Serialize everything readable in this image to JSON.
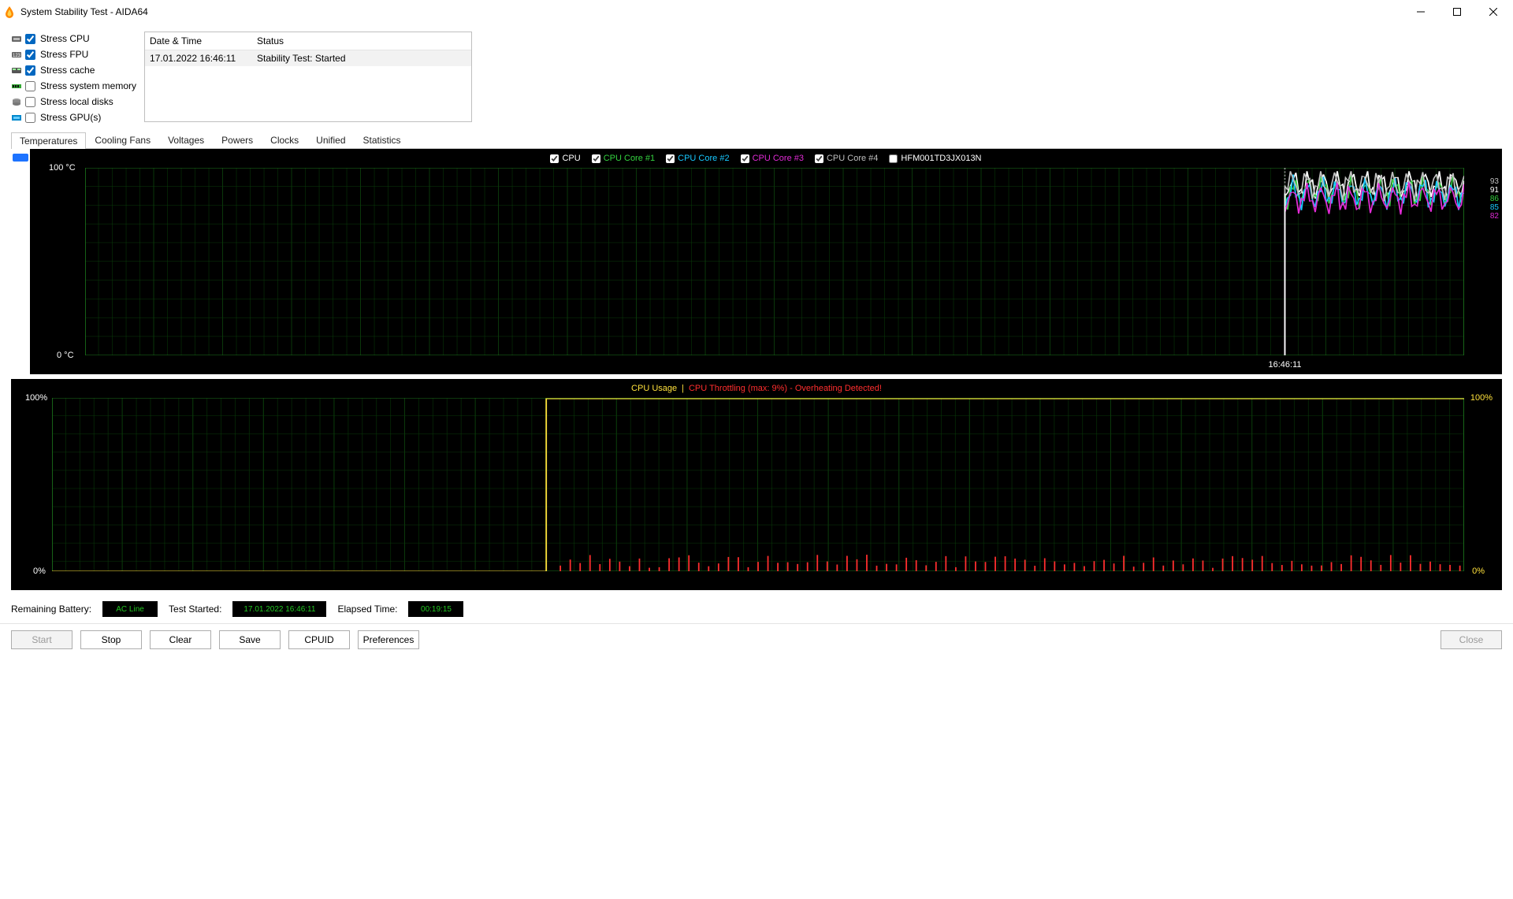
{
  "window": {
    "title": "System Stability Test - AIDA64"
  },
  "stress_options": [
    {
      "label": "Stress CPU",
      "checked": true
    },
    {
      "label": "Stress FPU",
      "checked": true
    },
    {
      "label": "Stress cache",
      "checked": true
    },
    {
      "label": "Stress system memory",
      "checked": false
    },
    {
      "label": "Stress local disks",
      "checked": false
    },
    {
      "label": "Stress GPU(s)",
      "checked": false
    }
  ],
  "event_log": {
    "headers": {
      "datetime": "Date & Time",
      "status": "Status"
    },
    "rows": [
      {
        "datetime": "17.01.2022 16:46:11",
        "status": "Stability Test: Started"
      }
    ]
  },
  "tabs": [
    {
      "label": "Temperatures",
      "active": true
    },
    {
      "label": "Cooling Fans",
      "active": false
    },
    {
      "label": "Voltages",
      "active": false
    },
    {
      "label": "Powers",
      "active": false
    },
    {
      "label": "Clocks",
      "active": false
    },
    {
      "label": "Unified",
      "active": false
    },
    {
      "label": "Statistics",
      "active": false
    }
  ],
  "temp_chart": {
    "y_max": "100 °C",
    "y_min": "0 °C",
    "x_tick": "16:46:11",
    "legend": [
      {
        "label": "CPU",
        "color": "#ffffff",
        "checked": true
      },
      {
        "label": "CPU Core #1",
        "color": "#34d23f",
        "checked": true
      },
      {
        "label": "CPU Core #2",
        "color": "#17c8ff",
        "checked": true
      },
      {
        "label": "CPU Core #3",
        "color": "#e22bd6",
        "checked": true
      },
      {
        "label": "CPU Core #4",
        "color": "#bfbfbf",
        "checked": true
      },
      {
        "label": "HFM001TD3JX013N",
        "color": "#ffffff",
        "checked": false
      }
    ],
    "current_values": [
      {
        "value": "93",
        "color": "#bfbfbf"
      },
      {
        "value": "91",
        "color": "#ffffff"
      },
      {
        "value": "86",
        "color": "#34d23f"
      },
      {
        "value": "85",
        "color": "#17c8ff"
      },
      {
        "value": "82",
        "color": "#e22bd6"
      }
    ]
  },
  "usage_chart": {
    "header_ok": "CPU Usage",
    "header_sep": "|",
    "header_bad": "CPU Throttling (max: 9%) - Overheating Detected!",
    "y_max": "100%",
    "y_min": "0%"
  },
  "status": {
    "battery_label": "Remaining Battery:",
    "battery_value": "AC Line",
    "started_label": "Test Started:",
    "started_value": "17.01.2022 16:46:11",
    "elapsed_label": "Elapsed Time:",
    "elapsed_value": "00:19:15"
  },
  "buttons": {
    "start": "Start",
    "stop": "Stop",
    "clear": "Clear",
    "save": "Save",
    "cpuid": "CPUID",
    "preferences": "Preferences",
    "close": "Close"
  },
  "chart_data": [
    {
      "type": "line",
      "title": "Temperatures",
      "ylabel": "°C",
      "ylim": [
        0,
        100
      ],
      "x_time_marker": "16:46:11",
      "note": "Values approximated from pixels; signal occupies roughly the last 13% of the time axis and oscillates in the 82-93 °C band for all series.",
      "series": [
        {
          "name": "CPU",
          "approx_range": [
            85,
            93
          ],
          "last": 91
        },
        {
          "name": "CPU Core #1",
          "approx_range": [
            82,
            92
          ],
          "last": 86
        },
        {
          "name": "CPU Core #2",
          "approx_range": [
            82,
            92
          ],
          "last": 85
        },
        {
          "name": "CPU Core #3",
          "approx_range": [
            80,
            90
          ],
          "last": 82
        },
        {
          "name": "CPU Core #4",
          "approx_range": [
            85,
            93
          ],
          "last": 93
        }
      ]
    },
    {
      "type": "line",
      "title": "CPU Usage / CPU Throttling",
      "ylabel": "%",
      "ylim": [
        0,
        100
      ],
      "note": "CPU usage plateaus at 100% from ~35% of the time axis onward. Throttling spikes intermittently between 0 % and ~9 %.",
      "series": [
        {
          "name": "CPU Usage",
          "approx_range": [
            0,
            100
          ],
          "plateau": 100
        },
        {
          "name": "CPU Throttling",
          "approx_range": [
            0,
            9
          ],
          "max": 9
        }
      ]
    }
  ]
}
